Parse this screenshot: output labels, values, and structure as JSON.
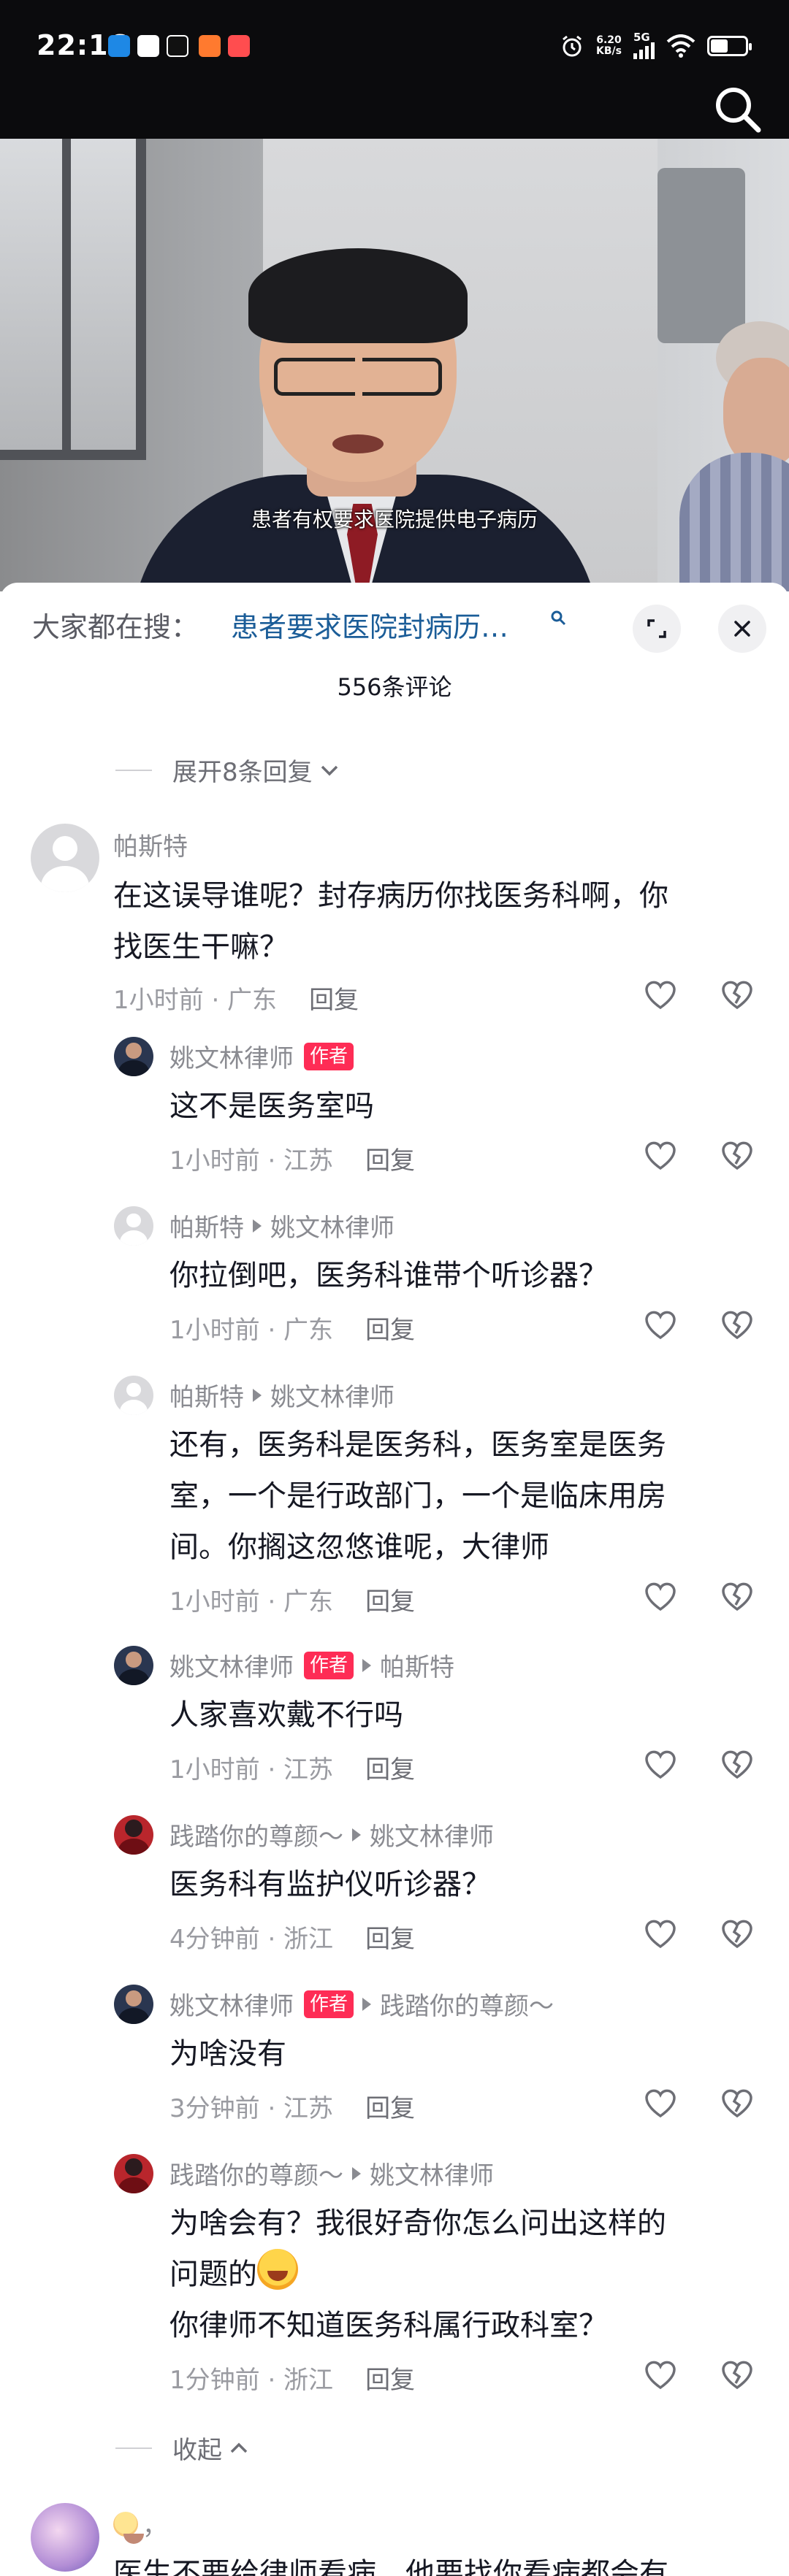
{
  "status_bar": {
    "time": "22:16",
    "net_speed_value": "6.20",
    "net_speed_unit": "KB/s",
    "signal": "5G",
    "battery_level": 0.5
  },
  "video": {
    "subtitle": "患者有权要求医院提供电子病历"
  },
  "search_bar": {
    "prefix": "大家都在搜：",
    "query": "患者要求医院封病历…",
    "query_icon": "search-icon"
  },
  "comment_count": "556条评论",
  "expand_label": "展开8条回复",
  "collapse_label": "收起",
  "comments": [
    {
      "user": "帕斯特",
      "text": [
        "在这误导谁呢？封存病历你找医务科啊，你",
        "找医生干嘛？"
      ],
      "time": "1小时前 · 广东",
      "reply": "回复"
    },
    {
      "user": "姚文林律师",
      "tag": "作者",
      "text": [
        "这不是医务室吗"
      ],
      "time": "1小时前 · 江苏",
      "reply": "回复"
    },
    {
      "user": "帕斯特",
      "to": "姚文林律师",
      "text": [
        "你拉倒吧，医务科谁带个听诊器？"
      ],
      "time": "1小时前 · 广东",
      "reply": "回复"
    },
    {
      "user": "帕斯特",
      "to": "姚文林律师",
      "text": [
        "还有，医务科是医务科，医务室是医务",
        "室，一个是行政部门，一个是临床用房",
        "间。你搁这忽悠谁呢，大律师"
      ],
      "time": "1小时前 · 广东",
      "reply": "回复"
    },
    {
      "user": "姚文林律师",
      "tag": "作者",
      "to": "帕斯特",
      "text": [
        "人家喜欢戴不行吗"
      ],
      "time": "1小时前 · 江苏",
      "reply": "回复"
    },
    {
      "user": "践踏你的尊颜～",
      "to": "姚文林律师",
      "text": [
        "医务科有监护仪听诊器？"
      ],
      "time": "4分钟前 · 浙江",
      "reply": "回复"
    },
    {
      "user": "姚文林律师",
      "tag": "作者",
      "to": "践踏你的尊颜～",
      "text": [
        "为啥没有"
      ],
      "time": "3分钟前 · 江苏",
      "reply": "回复"
    },
    {
      "user": "践踏你的尊颜～",
      "to": "姚文林律师",
      "text": [
        "为啥会有？我很好奇你怎么问出这样的",
        "问题的",
        "你律师不知道医务科属行政科室？"
      ],
      "time": "1分钟前 · 浙江",
      "reply": "回复"
    },
    {
      "user": "，",
      "text": [
        "医生不要给律师看病，他要找你看病都会有"
      ]
    }
  ],
  "icons": {
    "like": "heart-outline-icon",
    "dislike": "broken-heart-icon",
    "expand": "chevron-down-icon",
    "collapse": "chevron-up-icon"
  }
}
